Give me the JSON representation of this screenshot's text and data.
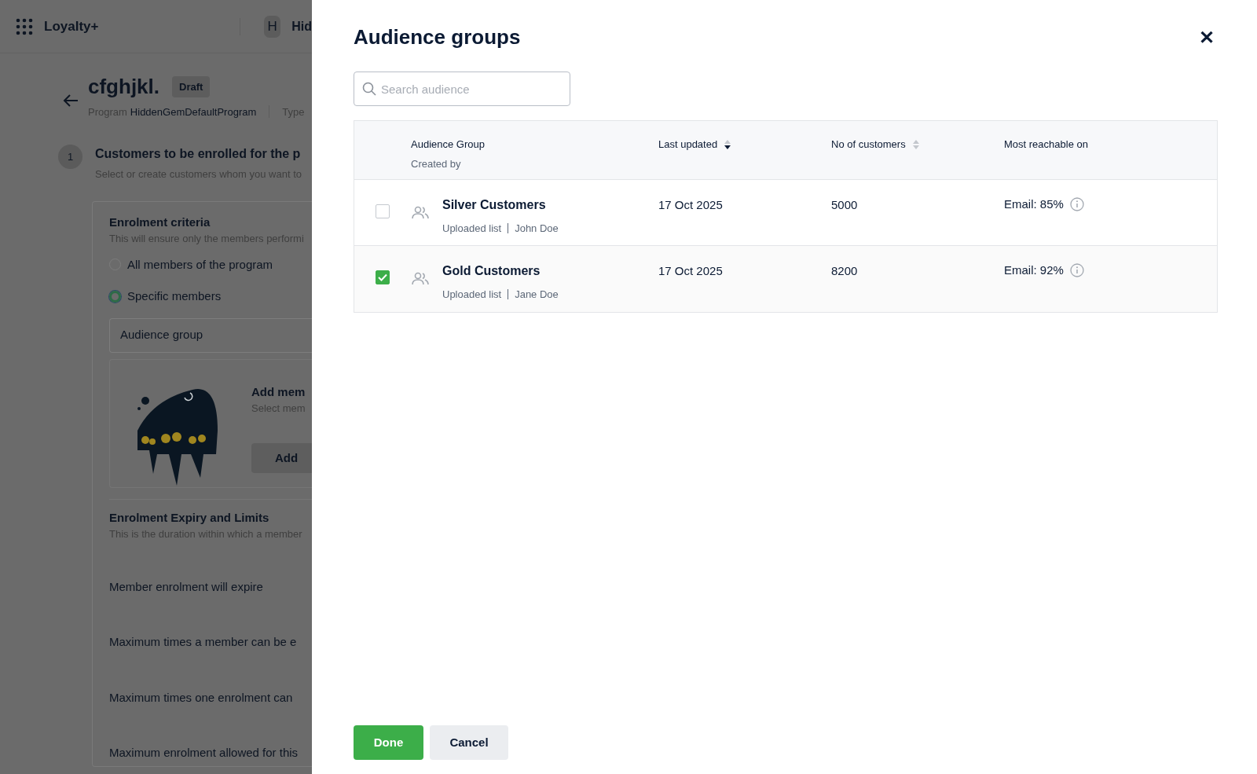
{
  "background": {
    "app_bar": {
      "logo": "Loyalty+",
      "avatar_initial": "H",
      "org_name": "Hid"
    },
    "header": {
      "title": "cfghjkl.",
      "badge": "Draft",
      "program_label": "Program",
      "program_value": "HiddenGemDefaultProgram",
      "type_label": "Type"
    },
    "step": {
      "number": "1",
      "title": "Customers to be enrolled for the p",
      "subtitle": "Select or create customers whom you want to"
    },
    "criteria": {
      "title": "Enrolment criteria",
      "subtitle": "This will ensure only the members performi",
      "options": [
        {
          "label": "All members of the program",
          "selected": false
        },
        {
          "label": "Specific members",
          "selected": true
        }
      ],
      "select_value": "Audience group",
      "add_members": {
        "title": "Add mem",
        "subtitle": "Select mem",
        "button": "Add"
      }
    },
    "expiry": {
      "title": "Enrolment Expiry and Limits",
      "subtitle": "This is the duration within which a member",
      "rows": [
        "Member enrolment will expire",
        "Maximum times a member can be e",
        "Maximum times one enrolment can",
        "Maximum enrolment allowed for this"
      ]
    }
  },
  "panel": {
    "title": "Audience groups",
    "close": "✕",
    "search": {
      "placeholder": "Search audience"
    },
    "columns": [
      {
        "label": "Audience Group",
        "sublabel": "Created by"
      },
      {
        "label": "Last updated",
        "sortable": true,
        "sorted": true
      },
      {
        "label": "No of customers",
        "sortable": true,
        "sorted": false
      },
      {
        "label": "Most reachable on"
      }
    ],
    "rows": [
      {
        "name": "Silver Customers",
        "source": "Uploaded list",
        "creator": "John Doe",
        "date": "17 Oct 2025",
        "customers": "5000",
        "reach": "Email: 85%",
        "checked": false
      },
      {
        "name": "Gold Customers",
        "source": "Uploaded list",
        "creator": "Jane Doe",
        "date": "17 Oct 2025",
        "customers": "8200",
        "reach": "Email: 92%",
        "checked": true
      }
    ],
    "buttons": {
      "done": "Done",
      "cancel": "Cancel"
    }
  }
}
